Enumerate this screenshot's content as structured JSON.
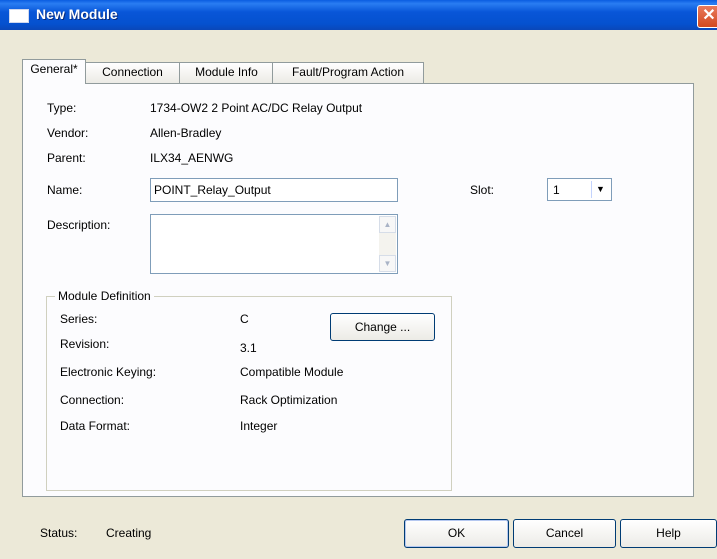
{
  "window": {
    "title": "New Module",
    "close_glyph": "✕"
  },
  "tabs": [
    {
      "label": "General*"
    },
    {
      "label": "Connection"
    },
    {
      "label": "Module Info"
    },
    {
      "label": "Fault/Program Action"
    }
  ],
  "general": {
    "type_label": "Type:",
    "type_value": "1734-OW2 2 Point AC/DC Relay Output",
    "vendor_label": "Vendor:",
    "vendor_value": "Allen-Bradley",
    "parent_label": "Parent:",
    "parent_value": "ILX34_AENWG",
    "name_label": "Name:",
    "name_value": "POINT_Relay_Output",
    "slot_label": "Slot:",
    "slot_value": "1",
    "description_label": "Description:",
    "description_value": ""
  },
  "module_definition": {
    "title": "Module Definition",
    "series_label": "Series:",
    "series_value": "C",
    "revision_label": "Revision:",
    "revision_value": "3.1",
    "keying_label": "Electronic Keying:",
    "keying_value": "Compatible Module",
    "connection_label": "Connection:",
    "connection_value": "Rack Optimization",
    "data_format_label": "Data Format:",
    "data_format_value": "Integer",
    "change_button": "Change ..."
  },
  "status": {
    "label": "Status:",
    "value": "Creating"
  },
  "buttons": {
    "ok": "OK",
    "cancel": "Cancel",
    "help": "Help"
  },
  "colors": {
    "titlebar": "#0856d8",
    "dialog_bg": "#ece9d8",
    "panel_bg": "#fcfcfe"
  }
}
